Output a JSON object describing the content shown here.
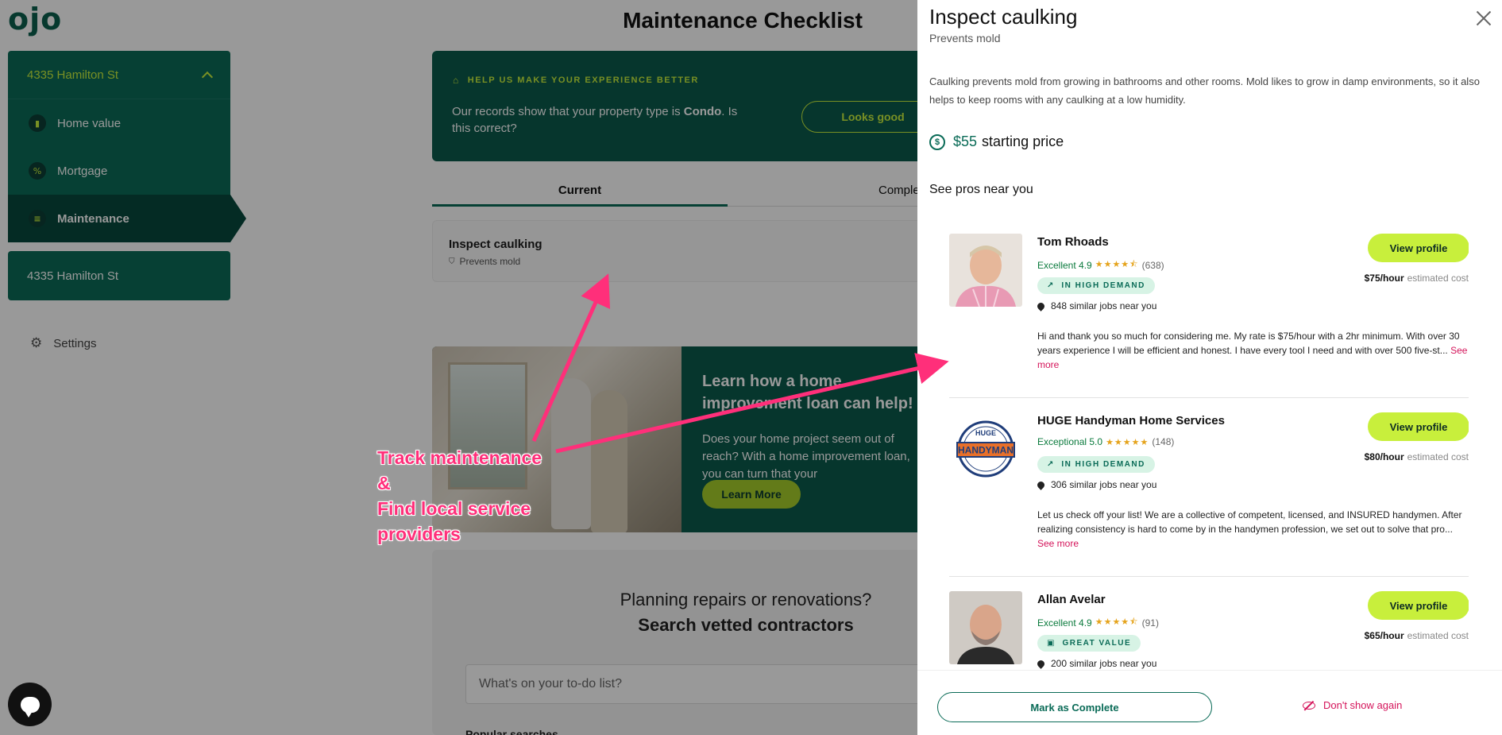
{
  "app": {
    "logo": "ojo"
  },
  "sidebar": {
    "property": "4335 Hamilton St",
    "items": [
      {
        "label": "Home value",
        "icon": "bar-chart-icon"
      },
      {
        "label": "Mortgage",
        "icon": "percent-icon"
      },
      {
        "label": "Maintenance",
        "icon": "list-icon"
      }
    ],
    "second_property": "4335 Hamilton St",
    "settings_label": "Settings"
  },
  "main": {
    "title": "Maintenance Checklist",
    "banner": {
      "kicker": "HELP US MAKE YOUR EXPERIENCE BETTER",
      "message_pre": "Our records show that your property type is ",
      "message_bold": "Condo",
      "message_post": ". Is this correct?",
      "button": "Looks good"
    },
    "tabs": {
      "current": "Current",
      "completed": "Completed"
    },
    "task": {
      "title": "Inspect caulking",
      "subtitle": "Prevents mold"
    },
    "promo": {
      "title": "Learn how a home improvement loan can help!",
      "text": "Does your home project seem out of reach? With a home improvement loan, you can turn that your",
      "button": "Learn More"
    },
    "contractors": {
      "line1": "Planning repairs or renovations?",
      "line2": "Search vetted contractors",
      "placeholder": "What's on your to-do list?",
      "popular": "Popular searches"
    }
  },
  "annotation": {
    "line1": "Track maintenance",
    "line2": "&",
    "line3": "Find local service",
    "line4": "providers",
    "color": "#ff2f7a"
  },
  "drawer": {
    "title": "Inspect caulking",
    "subtitle": "Prevents mold",
    "description": "Caulking prevents mold from growing in bathrooms and other rooms. Mold likes to grow in damp environments, so it also helps to keep rooms with any caulking at a low humidity.",
    "price_amount": "$55",
    "price_label": "starting price",
    "see_pros": "See pros near you",
    "pros": [
      {
        "name": "Tom Rhoads",
        "rating_label": "Excellent 4.9",
        "stars": "★★★★⯪",
        "reviews": "(638)",
        "badge": "IN HIGH DEMAND",
        "badge_icon": "trending-up-icon",
        "jobs": "848 similar jobs near you",
        "bio": "Hi and thank you so much for considering me. My rate is $75/hour with a 2hr minimum. With over 30 years experience I will be efficient and honest. I have every tool I need and with over 500 five-st...",
        "see_more": "See more",
        "button": "View profile",
        "rate": "$75/hour",
        "rate_label": "estimated cost"
      },
      {
        "name": "HUGE Handyman Home Services",
        "rating_label": "Exceptional 5.0",
        "stars": "★★★★★",
        "reviews": "(148)",
        "badge": "IN HIGH DEMAND",
        "badge_icon": "trending-up-icon",
        "jobs": "306 similar jobs near you",
        "bio": "Let us check off your list! We are a collective of competent, licensed, and INSURED handymen. After realizing consistency is hard to come by in the handymen profession, we set out to solve that pro...",
        "see_more": "See more",
        "button": "View profile",
        "rate": "$80/hour",
        "rate_label": "estimated cost",
        "logo_text_top": "HUGE",
        "logo_text_main": "HANDYMAN"
      },
      {
        "name": "Allan Avelar",
        "rating_label": "Excellent 4.9",
        "stars": "★★★★⯪",
        "reviews": "(91)",
        "badge": "GREAT VALUE",
        "badge_icon": "tag-icon",
        "jobs": "200 similar jobs near you",
        "button": "View profile",
        "rate": "$65/hour",
        "rate_label": "estimated cost"
      }
    ],
    "footer": {
      "complete": "Mark as Complete",
      "dont_show": "Don't show again"
    }
  },
  "colors": {
    "brand_green": "#0a6b57",
    "accent_lime": "#c8ef3c",
    "link_pink": "#d4145a"
  }
}
